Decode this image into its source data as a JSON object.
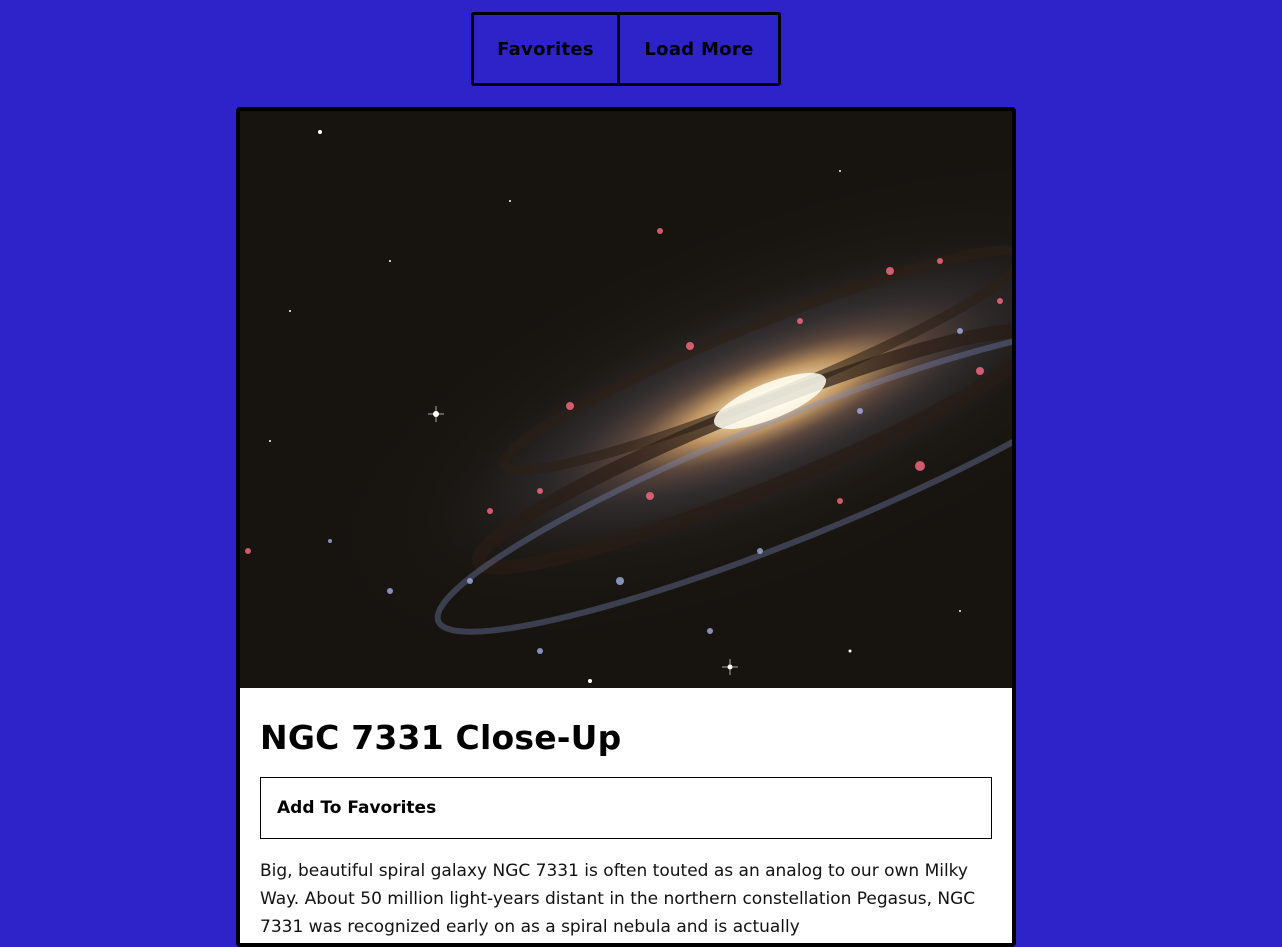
{
  "nav": {
    "favorites_label": "Favorites",
    "load_more_label": "Load More"
  },
  "card": {
    "image_alt": "NGC 7331 Close-Up",
    "title": "NGC 7331 Close-Up",
    "add_favorite_label": "Add To Favorites",
    "explanation": "Big, beautiful spiral galaxy NGC 7331 is often touted as an analog to our own Milky Way. About 50 million light-years distant in the northern constellation Pegasus, NGC 7331 was recognized early on as a spiral nebula and is actually"
  },
  "colors": {
    "page_background": "#2e23c8",
    "border": "#000000",
    "card_background": "#ffffff"
  }
}
